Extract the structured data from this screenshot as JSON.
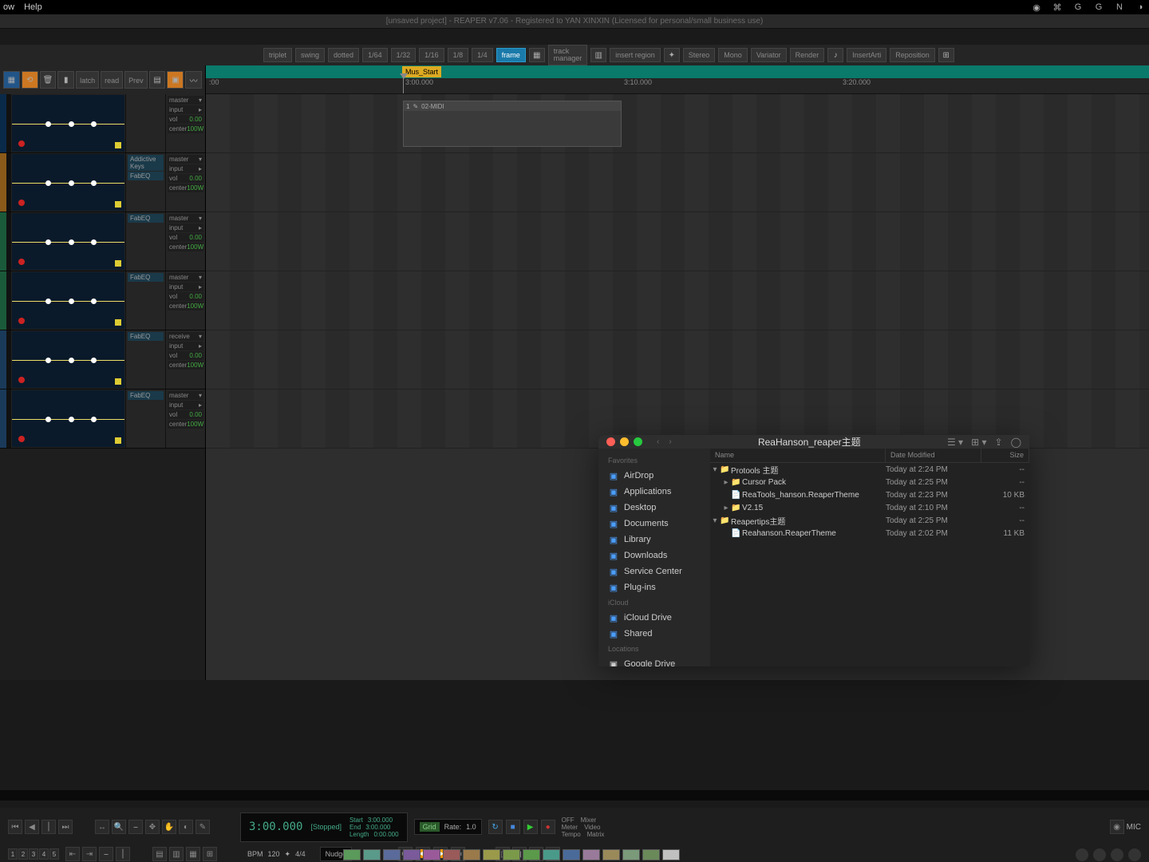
{
  "menubar": {
    "items": [
      "ow",
      "Help"
    ]
  },
  "titlebar": "[unsaved project] - REAPER v7.06 - Registered to YAN XINXIN (Licensed for personal/small business use)",
  "toolbar1": {
    "grid_buttons": [
      "triplet",
      "swing",
      "dotted",
      "1/64",
      "1/32",
      "1/16",
      "1/8",
      "1/4"
    ],
    "frame": "frame",
    "track_manager": "track\nmanager",
    "insert_region": "insert region",
    "stereo": "Stereo",
    "mono": "Mono",
    "variator": "Variator",
    "render": "Render",
    "insert_arti": "InsertArti",
    "reposition": "Reposition"
  },
  "left_tools": {
    "latch": "latch",
    "read": "read",
    "prev": "Prev"
  },
  "marker": {
    "label": "Mus_Start"
  },
  "ruler": {
    "t0": ":00",
    "t1": "3:00.000",
    "t2": "3:10.000",
    "t3": "3:20.000"
  },
  "clip": {
    "label": "02-MIDI"
  },
  "tracks": [
    {
      "fx": [],
      "ctrl": {
        "master": "master",
        "input": "input",
        "vol": "vol",
        "vol_val": "0.00",
        "center": "center",
        "center_val": "100W"
      }
    },
    {
      "fx": [
        "Addictive Keys",
        "FabEQ"
      ],
      "ctrl": {
        "master": "master",
        "input": "input",
        "vol": "vol",
        "vol_val": "0.00",
        "center": "center",
        "center_val": "100W"
      }
    },
    {
      "fx": [
        "FabEQ"
      ],
      "ctrl": {
        "master": "master",
        "input": "input",
        "vol": "vol",
        "vol_val": "0.00",
        "center": "center",
        "center_val": "100W"
      }
    },
    {
      "fx": [
        "FabEQ"
      ],
      "ctrl": {
        "master": "master",
        "input": "input",
        "vol": "vol",
        "vol_val": "0.00",
        "center": "center",
        "center_val": "100W"
      }
    },
    {
      "fx": [
        "FabEQ"
      ],
      "ctrl": {
        "master": "receive",
        "input": "input",
        "vol": "vol",
        "vol_val": "0.00",
        "center": "center",
        "center_val": "100W"
      }
    },
    {
      "fx": [
        "FabEQ"
      ],
      "ctrl": {
        "master": "master",
        "input": "input",
        "vol": "vol",
        "vol_val": "0.00",
        "center": "center",
        "center_val": "100W"
      }
    }
  ],
  "finder": {
    "title": "ReaHanson_reaper主题",
    "sidebar": {
      "favorites_header": "Favorites",
      "favorites": [
        "AirDrop",
        "Applications",
        "Desktop",
        "Documents",
        "Library",
        "Downloads",
        "Service Center",
        "Plug-ins"
      ],
      "icloud_header": "iCloud",
      "icloud": [
        "iCloud Drive",
        "Shared"
      ],
      "locations_header": "Locations",
      "locations": [
        "Google Drive"
      ]
    },
    "columns": {
      "name": "Name",
      "date": "Date Modified",
      "size": "Size"
    },
    "rows": [
      {
        "indent": 0,
        "disclosure": "▾",
        "icon": "folder",
        "name": "Protools 主题",
        "date": "Today at 2:24 PM",
        "size": "--"
      },
      {
        "indent": 1,
        "disclosure": "▸",
        "icon": "folder",
        "name": "Cursor Pack",
        "date": "Today at 2:25 PM",
        "size": "--"
      },
      {
        "indent": 1,
        "disclosure": "",
        "icon": "file",
        "name": "ReaTools_hanson.ReaperTheme",
        "date": "Today at 2:23 PM",
        "size": "10 KB"
      },
      {
        "indent": 1,
        "disclosure": "▸",
        "icon": "folder",
        "name": "V2.15",
        "date": "Today at 2:10 PM",
        "size": "--"
      },
      {
        "indent": 0,
        "disclosure": "▾",
        "icon": "folder",
        "name": "Reapertips主题",
        "date": "Today at 2:25 PM",
        "size": "--"
      },
      {
        "indent": 1,
        "disclosure": "",
        "icon": "file",
        "name": "Reahanson.ReaperTheme",
        "date": "Today at 2:02 PM",
        "size": "11 KB"
      }
    ]
  },
  "transport": {
    "time": "3:00.000",
    "status": "[Stopped]",
    "start_label": "Start",
    "start_val": "3:00.000",
    "end_label": "End",
    "end_val": "3:00.000",
    "length_label": "Length",
    "length_val": "0:00.000",
    "grid": "Grid",
    "rate": "Rate:",
    "rate_val": "1.0",
    "nudge": "Nudge",
    "bpm_label": "BPM",
    "bpm_val": "120",
    "sig": "4/4",
    "matrix": {
      "off": "OFF",
      "mixer": "Mixer",
      "meter": "Meter",
      "video": "Video",
      "tempo": "Tempo",
      "matrix": "Matrix"
    },
    "mic": "MIC"
  },
  "swatch_colors": [
    "#5a9a5a",
    "#5a9a8a",
    "#5a6a9a",
    "#7a5a9a",
    "#9a5a9a",
    "#9a5a5a",
    "#9a7a4a",
    "#9a9a4a",
    "#7a9a4a",
    "#5a9a4a",
    "#4a9a8a",
    "#4a6a9a",
    "#9a7a9a",
    "#9a8a5a",
    "#7a9a7a",
    "#6a8a5a",
    "#c0c0c0"
  ]
}
